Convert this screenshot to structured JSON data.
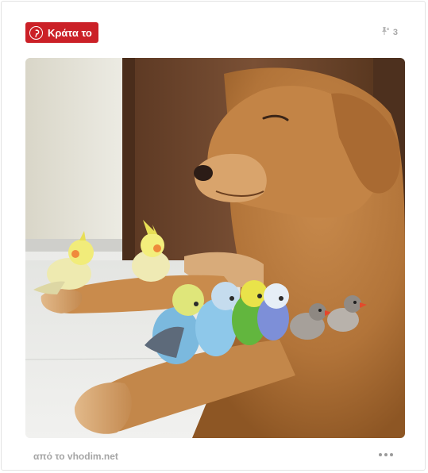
{
  "pin": {
    "save_label": "Κράτα το",
    "repin_count": "3",
    "source_text": "από το vhodim.net",
    "image_alt": "Golden retriever lying down with cockatiels, budgies and finches perched on its paw"
  },
  "colors": {
    "save_button": "#cb2027",
    "muted_text": "#a5a5a5",
    "card_border": "#e3e3e3"
  },
  "icons": {
    "logo": "pinterest-logo-icon",
    "repin": "pin-icon",
    "more": "ellipsis-icon"
  }
}
